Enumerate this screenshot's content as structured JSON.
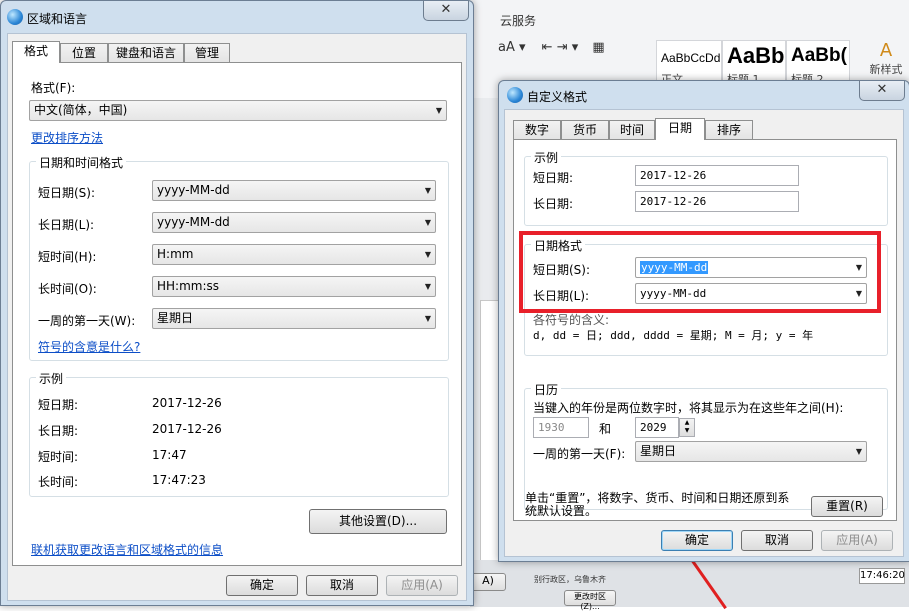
{
  "background_app": {
    "ribbon_tab": "云服务",
    "style_samples": [
      {
        "sample": "AaBbCcDd",
        "name": "正文"
      },
      {
        "sample": "AaBb",
        "name": "标题 1"
      },
      {
        "sample": "AaBb(",
        "name": "标题 2"
      }
    ],
    "new_style_label": "新样式",
    "bottom_texts": [
      "A)",
      "别行政区，乌鲁木齐",
      "更改时区(Z)..."
    ],
    "clock_text": "17:46:20"
  },
  "region_dialog": {
    "title": "区域和语言",
    "close_glyph": "✕",
    "tabs": [
      "格式",
      "位置",
      "键盘和语言",
      "管理"
    ],
    "format_label": "格式(F):",
    "format_value": "中文(简体，中国)",
    "sort_link": "更改排序方法",
    "datetime_group_title": "日期和时间格式",
    "rows": [
      {
        "label": "短日期(S):",
        "value": "yyyy-MM-dd"
      },
      {
        "label": "长日期(L):",
        "value": "yyyy-MM-dd"
      },
      {
        "label": "短时间(H):",
        "value": "H:mm"
      },
      {
        "label": "长时间(O):",
        "value": "HH:mm:ss"
      },
      {
        "label": "一周的第一天(W):",
        "value": "星期日"
      }
    ],
    "symbols_link": "符号的含意是什么?",
    "example_group_title": "示例",
    "examples": [
      {
        "label": "短日期:",
        "value": "2017-12-26"
      },
      {
        "label": "长日期:",
        "value": "2017-12-26"
      },
      {
        "label": "短时间:",
        "value": "17:47"
      },
      {
        "label": "长时间:",
        "value": "17:47:23"
      }
    ],
    "other_settings_button": "其他设置(D)...",
    "online_link": "联机获取更改语言和区域格式的信息",
    "ok_button": "确定",
    "cancel_button": "取消",
    "apply_button": "应用(A)"
  },
  "custom_dialog": {
    "title": "自定义格式",
    "close_glyph": "✕",
    "tabs": [
      "数字",
      "货币",
      "时间",
      "日期",
      "排序"
    ],
    "example_group_title": "示例",
    "short_date_label": "短日期:",
    "short_date_example": "2017-12-26",
    "long_date_label": "长日期:",
    "long_date_example": "2017-12-26",
    "date_format_group_title": "日期格式",
    "short_date_format_label": "短日期(S):",
    "short_date_format_value": "yyyy-MM-dd",
    "long_date_format_label": "长日期(L):",
    "long_date_format_value": "yyyy-MM-dd",
    "symbol_note_partial": "各符号的含义:",
    "symbol_legend": "d, dd = 日;  ddd, dddd = 星期;  M = 月;  y = 年",
    "calendar_group_title": "日历",
    "two_digit_year_text": "当键入的年份是两位数字时，将其显示为在这些年之间(H):",
    "year_from": "1930",
    "and_label": "和",
    "year_to": "2029",
    "first_day_label": "一周的第一天(F):",
    "first_day_value": "星期日",
    "reset_text": "单击“重置”，将数字、货币、时间和日期还原到系统默认设置。",
    "reset_button": "重置(R)",
    "ok_button": "确定",
    "cancel_button": "取消",
    "apply_button": "应用(A)"
  },
  "colors": {
    "highlight_box": "#e8202a",
    "link": "#0c4ec7",
    "selection": "#3399ff"
  }
}
